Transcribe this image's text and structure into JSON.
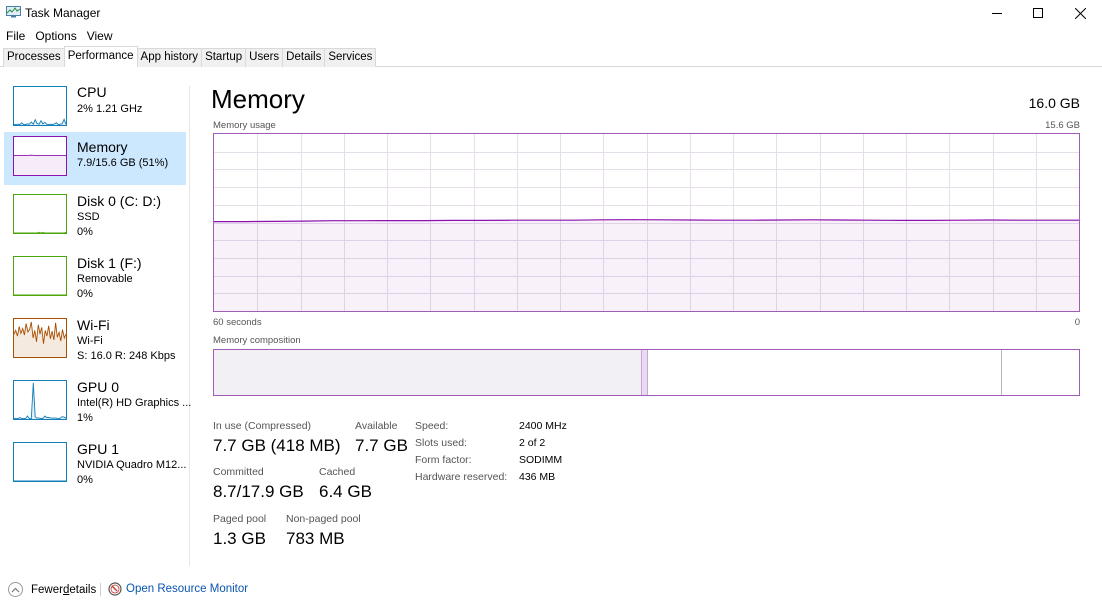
{
  "window": {
    "title": "Task Manager",
    "icon": "task-manager-icon",
    "controls": [
      "minimize-icon",
      "maximize-icon",
      "close-icon"
    ]
  },
  "menu": [
    "File",
    "Options",
    "View"
  ],
  "tabs": [
    {
      "label": "Processes",
      "active": false
    },
    {
      "label": "Performance",
      "active": true
    },
    {
      "label": "App history",
      "active": false
    },
    {
      "label": "Startup",
      "active": false
    },
    {
      "label": "Users",
      "active": false
    },
    {
      "label": "Details",
      "active": false
    },
    {
      "label": "Services",
      "active": false
    }
  ],
  "sidebar": {
    "items": [
      {
        "name": "CPU",
        "line1": "2% 1.21 GHz",
        "line2": "",
        "color": "#117dbb",
        "active": false
      },
      {
        "name": "Memory",
        "line1": "7.9/15.6 GB (51%)",
        "line2": "",
        "color": "#8b12ae",
        "active": true
      },
      {
        "name": "Disk 0 (C: D:)",
        "line1": "SSD",
        "line2": "0%",
        "color": "#4da60c",
        "active": false
      },
      {
        "name": "Disk 1 (F:)",
        "line1": "Removable",
        "line2": "0%",
        "color": "#4da60c",
        "active": false
      },
      {
        "name": "Wi-Fi",
        "line1": "Wi-Fi",
        "line2": "S: 16.0 R: 248 Kbps",
        "color": "#a74f01",
        "active": false
      },
      {
        "name": "GPU 0",
        "line1": "Intel(R) HD Graphics ...",
        "line2": "1%",
        "color": "#117dbb",
        "active": false
      },
      {
        "name": "GPU 1",
        "line1": "NVIDIA Quadro M12...",
        "line2": "0%",
        "color": "#117dbb",
        "active": false
      }
    ],
    "sparklines": {
      "cpu": [
        2,
        1,
        2,
        1,
        6,
        1,
        1,
        3,
        2,
        8,
        2,
        14,
        4,
        2,
        11,
        3,
        7,
        2,
        1,
        2,
        1,
        3,
        6,
        1,
        2,
        3,
        15,
        2
      ],
      "memory": [
        51,
        51,
        51,
        52,
        51,
        51,
        51,
        51,
        51,
        51
      ],
      "disk0": [
        0,
        0,
        0,
        0,
        0,
        0,
        0,
        0,
        0,
        0,
        0,
        0,
        0,
        2,
        0,
        2,
        0,
        0,
        0,
        0,
        0,
        0,
        0,
        0,
        0,
        0,
        0,
        2
      ],
      "disk1": [
        0,
        0,
        0,
        0,
        0,
        0,
        0,
        0,
        0,
        0
      ],
      "wifi": [
        60,
        70,
        55,
        80,
        62,
        75,
        58,
        88,
        66,
        72,
        92,
        50,
        70,
        40,
        85,
        60,
        78,
        35,
        70,
        55,
        82,
        48,
        68,
        45,
        90,
        52,
        65,
        42,
        72,
        50,
        60
      ],
      "gpu0": [
        2,
        1,
        1,
        4,
        1,
        1,
        1,
        8,
        1,
        1,
        95,
        6,
        2,
        3,
        1,
        1,
        8,
        4,
        4,
        3,
        2,
        3,
        2,
        1,
        2,
        6,
        5,
        2
      ],
      "gpu1": [
        0,
        0,
        0,
        0,
        0,
        0,
        0,
        0,
        0,
        0
      ]
    }
  },
  "main": {
    "heading": "Memory",
    "total": "16.0 GB",
    "usage_label": "Memory usage",
    "usage_max": "15.6 GB",
    "time_left": "60 seconds",
    "time_right": "0",
    "composition_label": "Memory composition",
    "accent": "#8b12ae",
    "usage_series_percent": [
      50.5,
      50.5,
      50.6,
      50.8,
      51.0,
      51.0,
      51.1,
      51.1,
      51.2,
      51.2,
      51.3,
      51.3,
      51.3,
      51.5,
      51.6,
      51.5,
      51.4,
      51.3,
      51.3,
      51.4,
      51.5,
      51.4,
      51.3,
      51.2,
      51.2,
      51.3,
      51.4,
      51.3,
      51.3,
      51.3
    ],
    "composition": {
      "in_use_fraction": 0.494,
      "modified_fraction": 0.008,
      "standby_fraction": 0.409,
      "free_fraction": 0.089
    },
    "stats": {
      "in_use_label": "In use (Compressed)",
      "in_use_value": "7.7 GB (418 MB)",
      "available_label": "Available",
      "available_value": "7.7 GB",
      "committed_label": "Committed",
      "committed_value": "8.7/17.9 GB",
      "cached_label": "Cached",
      "cached_value": "6.4 GB",
      "paged_label": "Paged pool",
      "paged_value": "1.3 GB",
      "nonpaged_label": "Non-paged pool",
      "nonpaged_value": "783 MB"
    },
    "properties": [
      {
        "key": "Speed:",
        "value": "2400 MHz"
      },
      {
        "key": "Slots used:",
        "value": "2 of 2"
      },
      {
        "key": "Form factor:",
        "value": "SODIMM"
      },
      {
        "key": "Hardware reserved:",
        "value": "436 MB"
      }
    ]
  },
  "footer": {
    "fewer_details_pre": "Fewer ",
    "fewer_details_underlined": "d",
    "fewer_details_post": "etails",
    "open_resource_monitor": "Open Resource Monitor"
  }
}
